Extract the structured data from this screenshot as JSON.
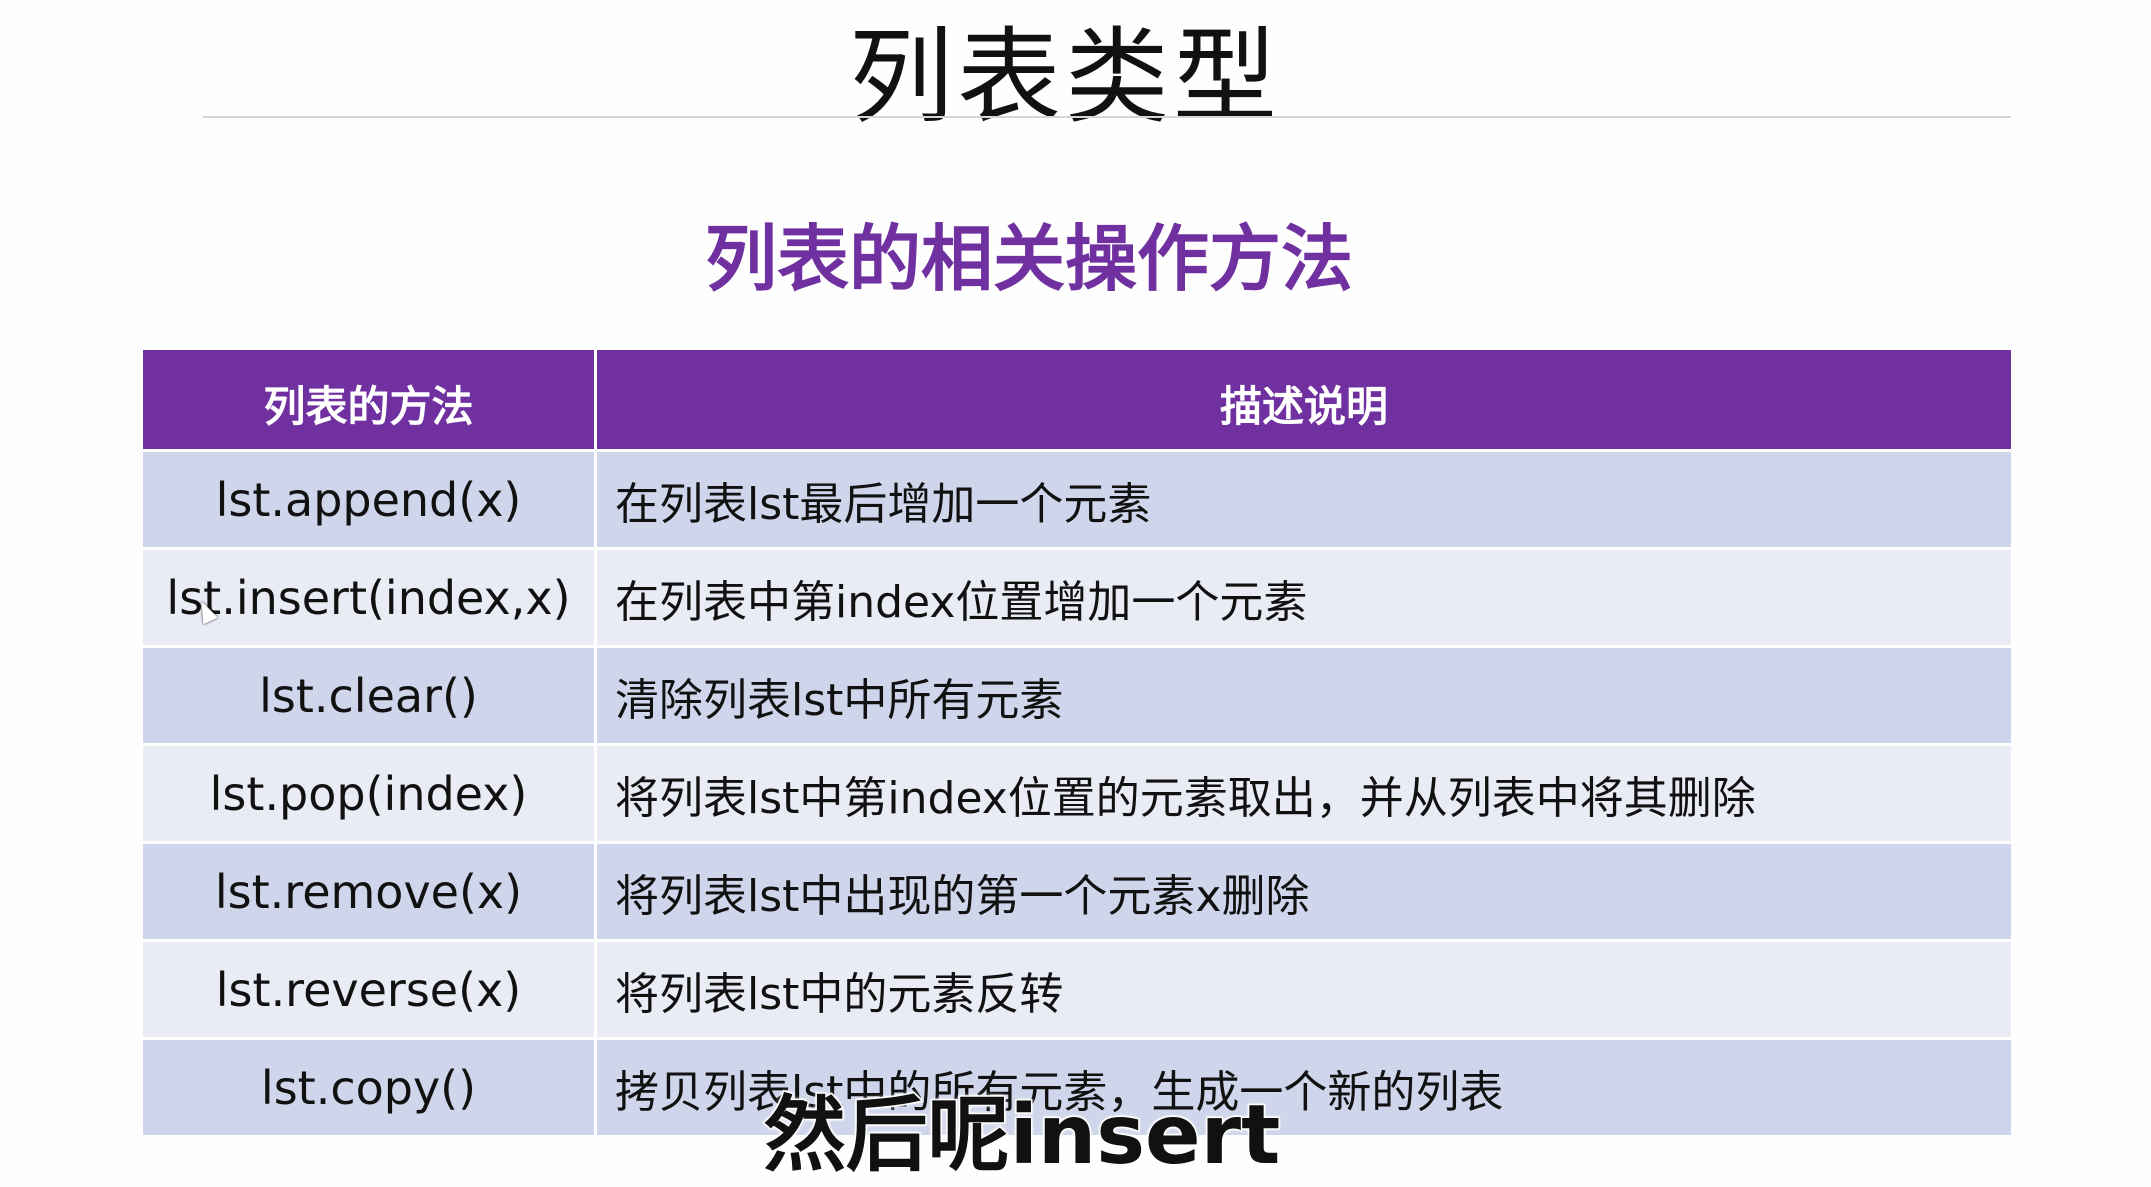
{
  "title": "列表类型",
  "subtitle": "列表的相关操作方法",
  "table": {
    "headers": [
      "列表的方法",
      "描述说明"
    ],
    "rows": [
      {
        "method": "lst.append(x)",
        "desc": "在列表lst最后增加一个元素"
      },
      {
        "method": "lst.insert(index,x)",
        "desc": "在列表中第index位置增加一个元素"
      },
      {
        "method": "lst.clear()",
        "desc": "清除列表lst中所有元素"
      },
      {
        "method": "lst.pop(index)",
        "desc": "将列表lst中第index位置的元素取出，并从列表中将其删除"
      },
      {
        "method": "lst.remove(x)",
        "desc": "将列表lst中出现的第一个元素x删除"
      },
      {
        "method": "lst.reverse(x)",
        "desc": "将列表lst中的元素反转"
      },
      {
        "method": "lst.copy()",
        "desc": "拷贝列表lst中的所有元素，生成一个新的列表"
      }
    ]
  },
  "caption": "然后呢insert",
  "colors": {
    "accent": "#7030a0",
    "row_dark": "#cfd5ea",
    "row_light": "#e9ebf5"
  }
}
